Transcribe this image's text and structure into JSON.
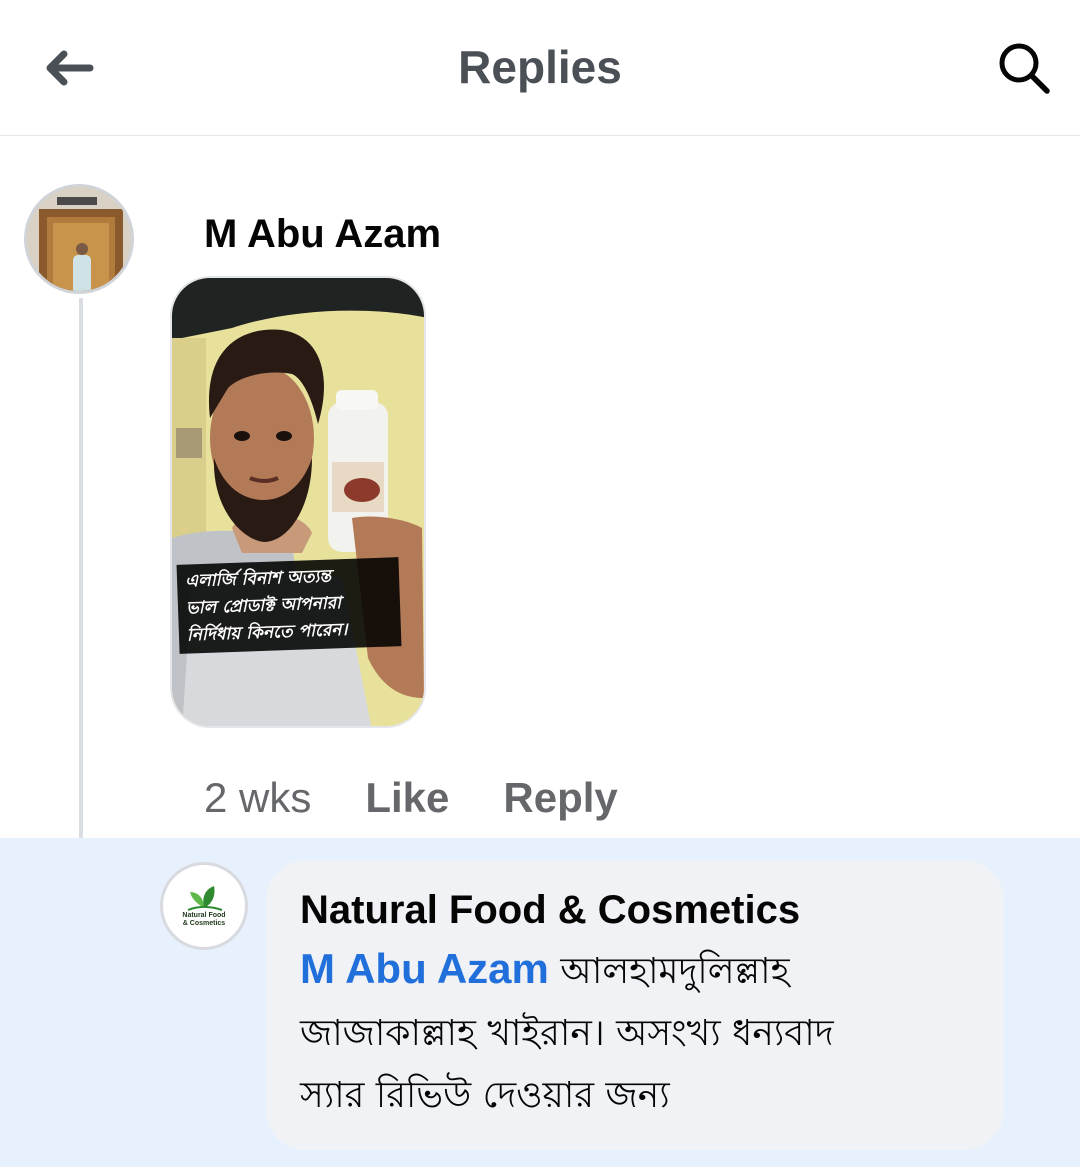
{
  "header": {
    "title": "Replies"
  },
  "comment": {
    "author": "M Abu Azam",
    "attachment_caption": [
      "এলার্জি বিনাশ অত্যন্ত",
      "ভাল প্রোডাক্ট আপনারা",
      "নির্দিধায় কিনতে পারেন।"
    ],
    "time": "2 wks",
    "like_label": "Like",
    "reply_label": "Reply"
  },
  "reply": {
    "author": "Natural Food & Cosmetics",
    "mention": "M Abu Azam",
    "text_line1": "আলহামদুলিল্লাহ",
    "text_line2": "জাজাকাল্লাহ খাইরান। অসংখ্য ধন্যবাদ",
    "text_line3": "স্যার রিভিউ দেওয়ার জন্য",
    "logo_line1": "Natural Food",
    "logo_line2": "& Cosmetics"
  },
  "colors": {
    "accent": "#216fdb",
    "reply_background": "#e7f1fd",
    "bubble": "#f0f2f5",
    "secondary_text": "#65676b"
  },
  "icons": {
    "back": "arrow-left-icon",
    "search": "search-icon"
  }
}
